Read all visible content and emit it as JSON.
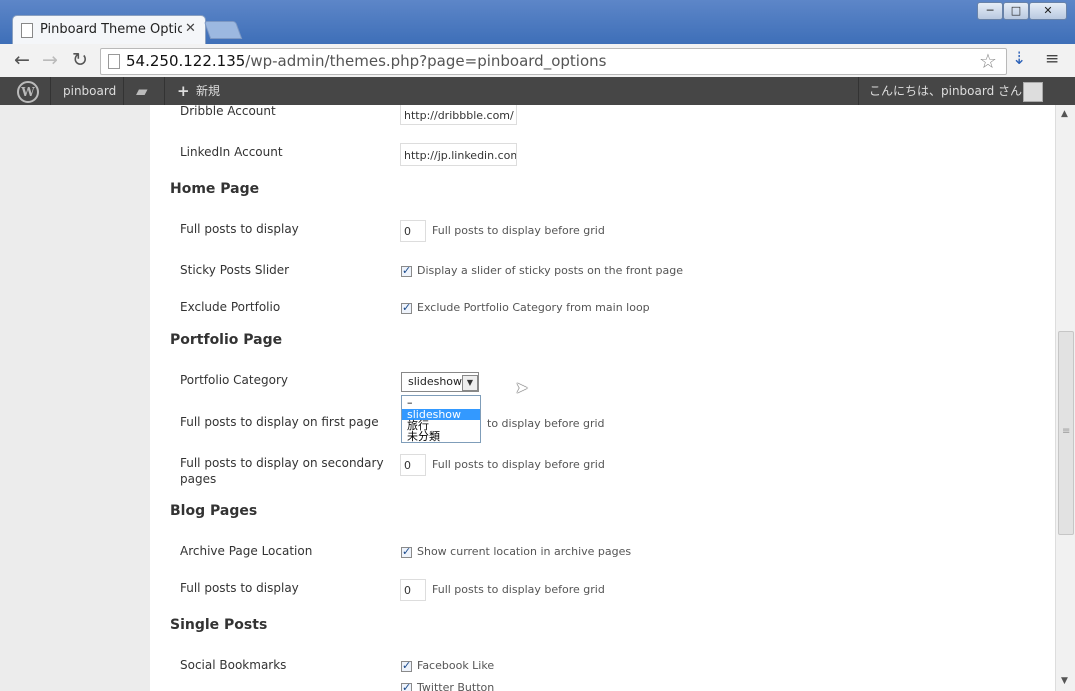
{
  "browser": {
    "tab_title": "Pinboard Theme Option",
    "url_host": "54.250.122.135",
    "url_path": "/wp-admin/themes.php?page=pinboard_options"
  },
  "adminbar": {
    "site_name": "pinboard",
    "new_label": "新規",
    "greeting": "こんにちは、pinboard さん !"
  },
  "social": {
    "dribbble_label": "Dribble Account",
    "dribbble_value": "http://dribbble.com/",
    "linkedin_label": "LinkedIn Account",
    "linkedin_value": "http://jp.linkedin.com."
  },
  "home": {
    "heading": "Home Page",
    "full_posts_label": "Full posts to display",
    "full_posts_value": "0",
    "full_posts_desc": "Full posts to display before grid",
    "sticky_label": "Sticky Posts Slider",
    "sticky_desc": "Display a slider of sticky posts on the front page",
    "exclude_label": "Exclude Portfolio",
    "exclude_desc": "Exclude Portfolio Category from main loop"
  },
  "portfolio": {
    "heading": "Portfolio Page",
    "category_label": "Portfolio Category",
    "category_value": "slideshow",
    "category_options": [
      "–",
      "slideshow",
      "旅行",
      "未分類"
    ],
    "first_page_label": "Full posts to display on first page",
    "first_page_desc": "to display before grid",
    "secondary_label_1": "Full posts to display on secondary",
    "secondary_label_2": "pages",
    "secondary_value": "0",
    "secondary_desc": "Full posts to display before grid"
  },
  "blog": {
    "heading": "Blog Pages",
    "archive_label": "Archive Page Location",
    "archive_desc": "Show current location in archive pages",
    "full_posts_label": "Full posts to display",
    "full_posts_value": "0",
    "full_posts_desc": "Full posts to display before grid"
  },
  "single": {
    "heading": "Single Posts",
    "social_label": "Social Bookmarks",
    "facebook_desc": "Facebook Like",
    "twitter_desc": "Twitter Button"
  }
}
